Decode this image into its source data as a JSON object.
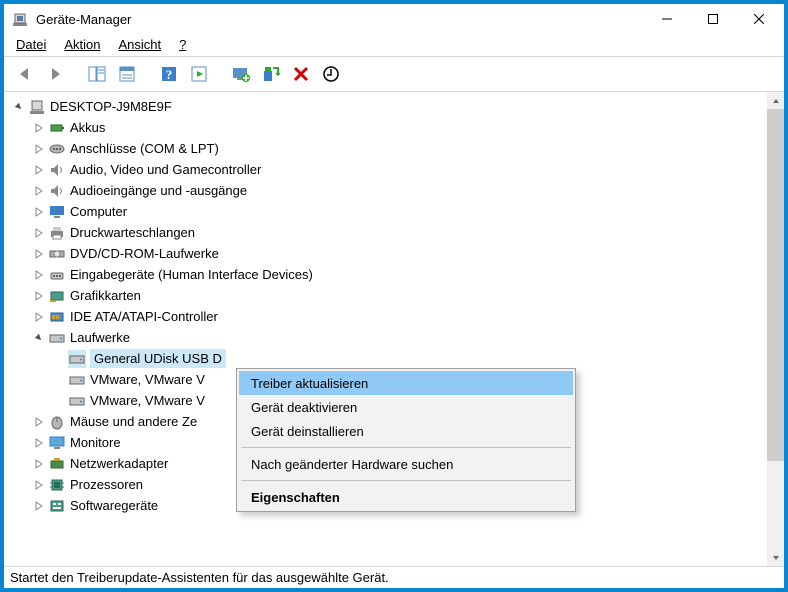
{
  "window": {
    "title": "Geräte-Manager"
  },
  "menu": {
    "datei": "Datei",
    "aktion": "Aktion",
    "ansicht": "Ansicht",
    "help": "?"
  },
  "tree": {
    "root": "DESKTOP-J9M8E9F",
    "akkus": "Akkus",
    "anschluesse": "Anschlüsse (COM & LPT)",
    "audio_video": "Audio, Video und Gamecontroller",
    "audioein": "Audioeingänge und -ausgänge",
    "computer": "Computer",
    "druck": "Druckwarteschlangen",
    "dvd": "DVD/CD-ROM-Laufwerke",
    "eingabe": "Eingabegeräte (Human Interface Devices)",
    "grafik": "Grafikkarten",
    "ide": "IDE ATA/ATAPI-Controller",
    "laufwerke": "Laufwerke",
    "udisk": "General UDisk USB D",
    "vmware1": "VMware, VMware V",
    "vmware2": "VMware, VMware V",
    "maeuse": "Mäuse und andere Ze",
    "monitore": "Monitore",
    "netzwerk": "Netzwerkadapter",
    "prozessoren": "Prozessoren",
    "software": "Softwaregeräte"
  },
  "context_menu": {
    "treiber_aktualisieren": "Treiber aktualisieren",
    "geraet_deaktivieren": "Gerät deaktivieren",
    "geraet_deinstallieren": "Gerät deinstallieren",
    "hardware_suchen": "Nach geänderter Hardware suchen",
    "eigenschaften": "Eigenschaften"
  },
  "statusbar": "Startet den Treiberupdate-Assistenten für das ausgewählte Gerät."
}
